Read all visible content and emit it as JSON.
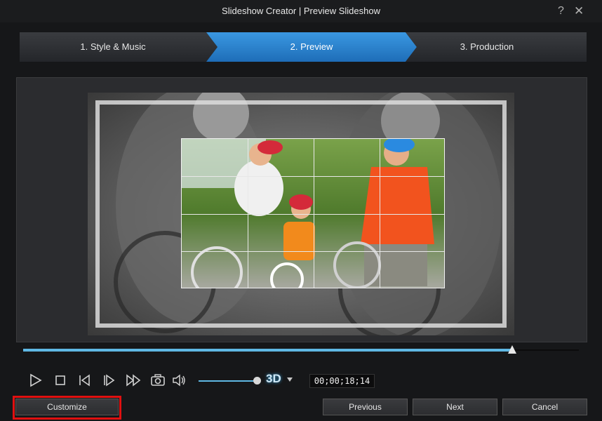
{
  "window": {
    "title": "Slideshow Creator | Preview Slideshow",
    "help_icon": "question-mark-icon",
    "close_icon": "close-icon"
  },
  "steps": [
    {
      "label": "1. Style & Music",
      "state": "done"
    },
    {
      "label": "2. Preview",
      "state": "active"
    },
    {
      "label": "3. Production",
      "state": "pending"
    }
  ],
  "colors": {
    "active_step": "#2f86d4",
    "accent": "#5fb8e4",
    "highlight": "#e01010"
  },
  "playback": {
    "progress_fraction": 0.88,
    "volume_fraction": 1.0,
    "timecode": "00;00;18;14",
    "three_d_label": "3D",
    "controls": [
      "play-icon",
      "stop-icon",
      "previous-frame-icon",
      "next-frame-icon",
      "fast-forward-icon",
      "snapshot-icon",
      "volume-icon"
    ]
  },
  "buttons": {
    "customize": "Customize",
    "previous": "Previous",
    "next": "Next",
    "cancel": "Cancel"
  }
}
